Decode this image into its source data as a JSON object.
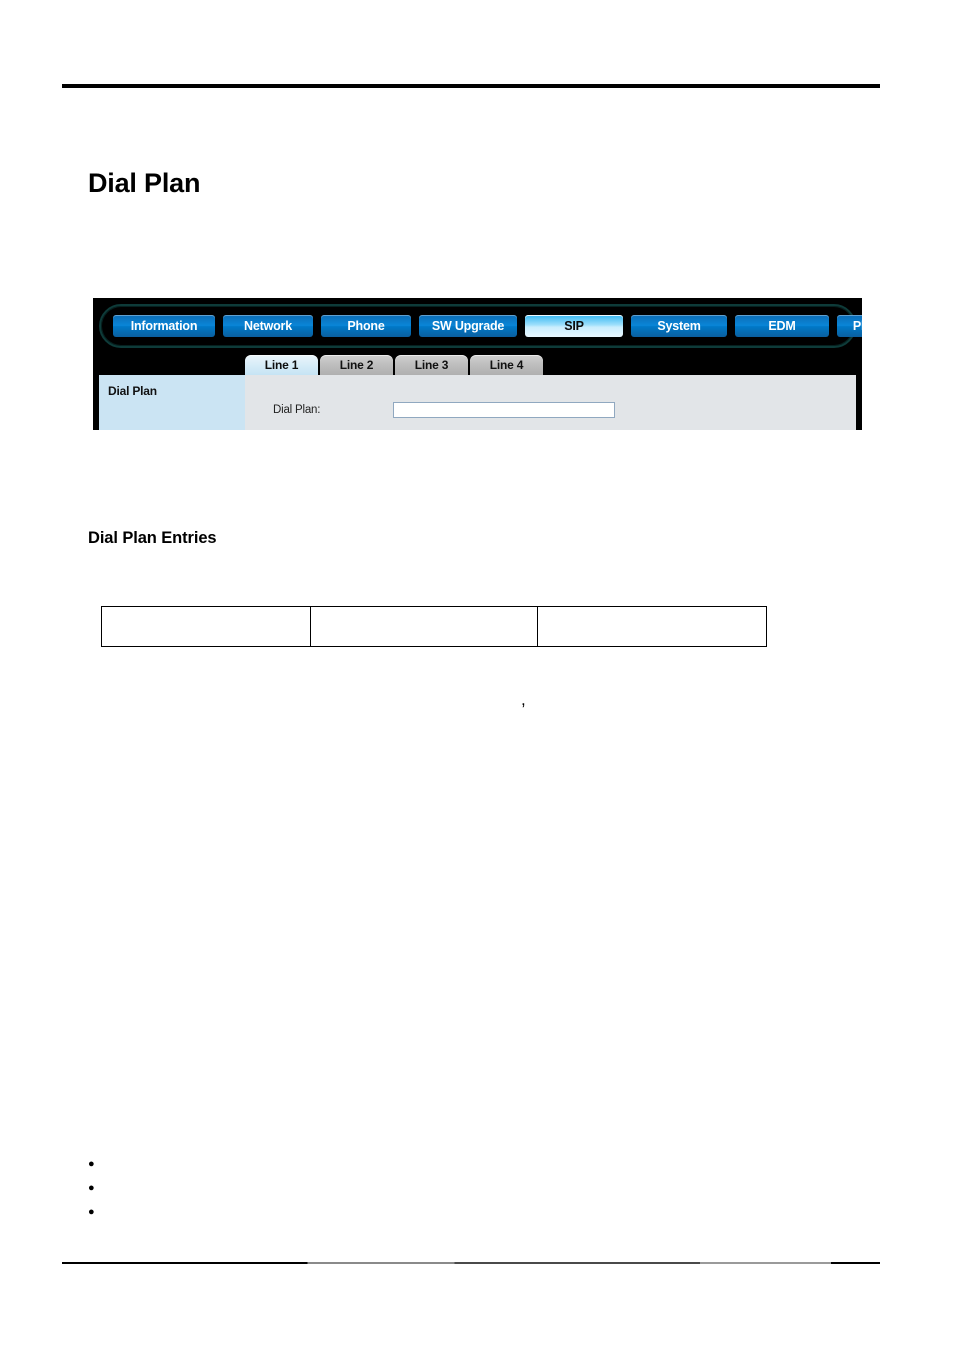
{
  "document": {
    "page_title": "Dial Plan",
    "section_title": "Dial Plan Entries"
  },
  "device_ui": {
    "nav": {
      "items": [
        {
          "label": "Information",
          "active": false
        },
        {
          "label": "Network",
          "active": false
        },
        {
          "label": "Phone",
          "active": false
        },
        {
          "label": "SW Upgrade",
          "active": false
        },
        {
          "label": "SIP",
          "active": true
        },
        {
          "label": "System",
          "active": false
        },
        {
          "label": "EDM",
          "active": false
        },
        {
          "label": "Phonebook",
          "active": false
        }
      ],
      "active_item": "SIP",
      "button_color": "#0a86d8",
      "active_button_color": "#9fe0fb",
      "shell_border_color": "#0e3b39",
      "background_color": "#000000"
    },
    "tabs": {
      "items": [
        {
          "label": "Line 1",
          "active": true
        },
        {
          "label": "Line 2",
          "active": false
        },
        {
          "label": "Line 3",
          "active": false
        },
        {
          "label": "Line 4",
          "active": false
        }
      ],
      "active_tab": "Line 1",
      "active_color": "#d4ebf7",
      "inactive_color": "#bdbdbd"
    },
    "panel": {
      "left_title": "Dial Plan",
      "left_background": "#cbe4f3",
      "right_background": "#e2e5e8",
      "field": {
        "label": "Dial Plan:",
        "value": "",
        "placeholder": ""
      }
    }
  },
  "entries_table": {
    "rows": [
      {
        "cells": [
          "",
          "",
          ""
        ]
      }
    ]
  },
  "note_glyph": ",",
  "bullets": [
    {
      "text": ""
    },
    {
      "text": ""
    },
    {
      "text": ""
    }
  ]
}
